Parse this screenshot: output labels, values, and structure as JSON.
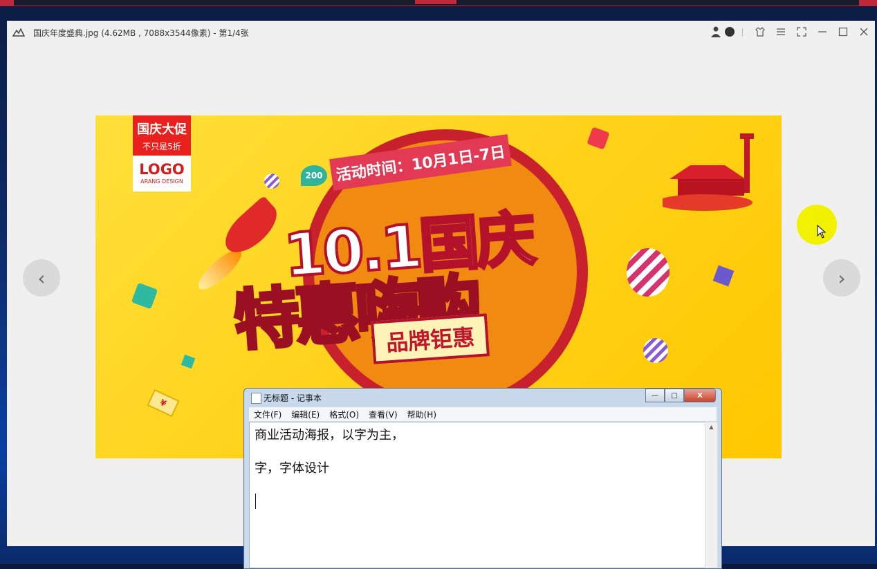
{
  "viewer": {
    "title": "国庆年度盛典.jpg (4.62MB , 7088x3544像素) - 第1/4张",
    "prev_arrow": "‹",
    "next_arrow": "›",
    "icons": [
      "app-logo-icon",
      "avatar-icon",
      "shield-icon",
      "shirt-icon",
      "menu-icon",
      "fullscreen-icon",
      "minimize-icon",
      "maximize-icon",
      "close-icon"
    ]
  },
  "poster": {
    "logo_line1": "国庆大促",
    "logo_line2": "不只是5折",
    "logo_line3": "LOGO",
    "logo_line4": "ARANG DESIGN",
    "ribbon": "活动时间：10月1日-7日",
    "badge": "200",
    "headline1": "10.1国庆",
    "headline2": "特惠嗨购",
    "headline3": "品牌钜惠",
    "coin": "¥",
    "colors": {
      "background": "#ffd21a",
      "primary_red": "#c8202c",
      "accent_pink": "#e23a55"
    }
  },
  "notepad": {
    "title": "无标题 - 记事本",
    "menus": [
      "文件(F)",
      "编辑(E)",
      "格式(O)",
      "查看(V)",
      "帮助(H)"
    ],
    "lines": [
      "商业活动海报，以字为主，",
      "",
      "字，字体设计"
    ],
    "btn_min": "—",
    "btn_max": "□",
    "btn_close": "X"
  }
}
